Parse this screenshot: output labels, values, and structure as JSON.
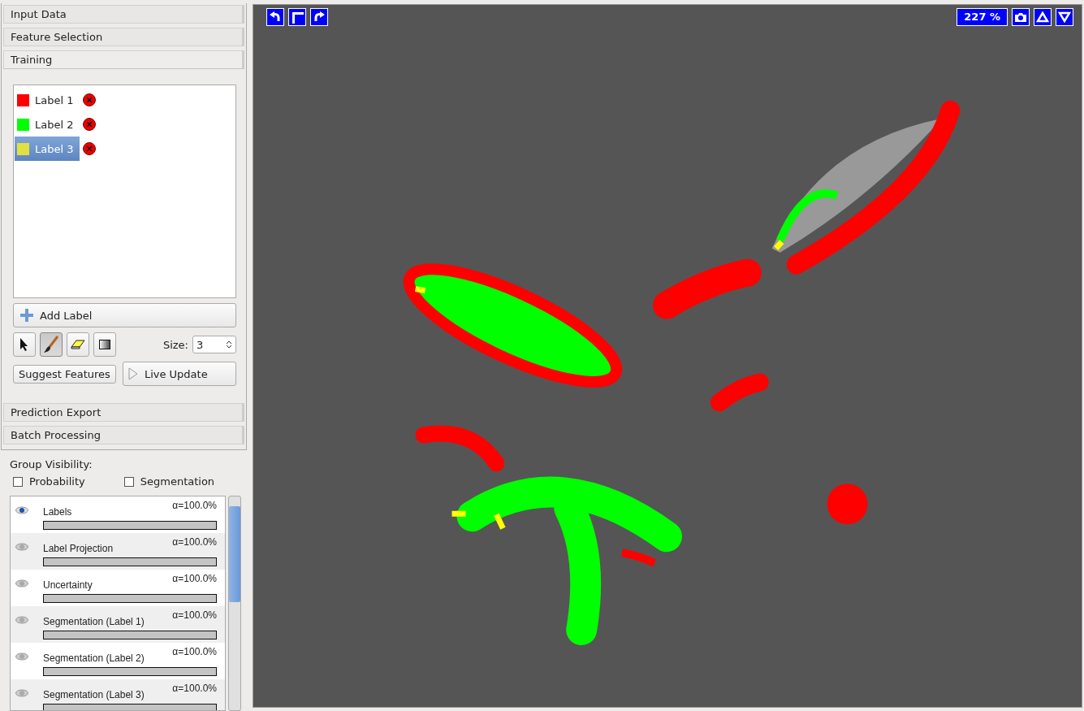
{
  "applets": [
    {
      "title": "Input Data",
      "expanded": false
    },
    {
      "title": "Feature Selection",
      "expanded": false
    },
    {
      "title": "Training",
      "expanded": true
    },
    {
      "title": "Prediction Export",
      "expanded": false
    },
    {
      "title": "Batch Processing",
      "expanded": false
    }
  ],
  "labels": [
    {
      "name": "Label 1",
      "color": "#ff0000",
      "selected": false
    },
    {
      "name": "Label 2",
      "color": "#00ff00",
      "selected": false
    },
    {
      "name": "Label 3",
      "color": "#e0e040",
      "selected": true
    }
  ],
  "add_label": "Add Label",
  "tools": [
    {
      "kind": "pointer",
      "selected": false
    },
    {
      "kind": "brush",
      "selected": true
    },
    {
      "kind": "eraser",
      "selected": false
    },
    {
      "kind": "threshold",
      "selected": false
    }
  ],
  "size_label": "Size:",
  "size_value": "3",
  "suggest_button": "Suggest Features",
  "live_update": "Live Update",
  "group_visibility": "Group Visibility:",
  "group_checks": [
    {
      "label": "Probability",
      "checked": false
    },
    {
      "label": "Segmentation",
      "checked": false
    }
  ],
  "layers": [
    {
      "name": "Labels",
      "opacity": "α=100.0%",
      "level": 1,
      "visible": true
    },
    {
      "name": "Label Projection",
      "opacity": "α=100.0%",
      "level": 1,
      "visible": false
    },
    {
      "name": "Uncertainty",
      "opacity": "α=100.0%",
      "level": 1,
      "visible": false
    },
    {
      "name": "Segmentation (Label 1)",
      "opacity": "α=100.0%",
      "level": 1,
      "visible": false
    },
    {
      "name": "Segmentation (Label 2)",
      "opacity": "α=100.0%",
      "level": 1,
      "visible": false
    },
    {
      "name": "Segmentation (Label 3)",
      "opacity": "α=100.0%",
      "level": 1,
      "visible": false
    }
  ],
  "viewer": {
    "zoom": "227 %"
  }
}
